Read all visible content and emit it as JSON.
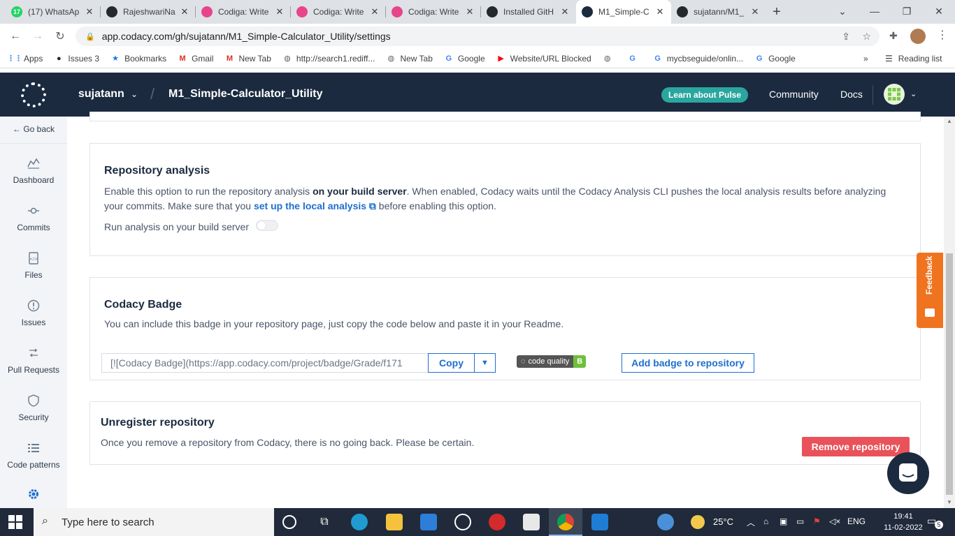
{
  "browser": {
    "tabs": [
      {
        "title": "(17) WhatsAp",
        "badge": "17",
        "color": "#25d366"
      },
      {
        "title": "RajeshwariNa",
        "color": "#24292e"
      },
      {
        "title": "Codiga: Write",
        "color": "#e8448b"
      },
      {
        "title": "Codiga: Write",
        "color": "#e8448b"
      },
      {
        "title": "Codiga: Write",
        "color": "#e8448b"
      },
      {
        "title": "Installed GitH",
        "color": "#24292e"
      },
      {
        "title": "M1_Simple-C",
        "color": "#1b2a3f",
        "active": true
      },
      {
        "title": "sujatann/M1_",
        "color": "#24292e"
      }
    ],
    "url": "app.codacy.com/gh/sujatann/M1_Simple-Calculator_Utility/settings",
    "bookmarks": [
      {
        "label": "Apps",
        "icon": "apps-grid-icon"
      },
      {
        "label": "Issues 3",
        "icon": "github-icon"
      },
      {
        "label": "Bookmarks",
        "icon": "star-icon"
      },
      {
        "label": "Gmail",
        "icon": "gmail-icon"
      },
      {
        "label": "New Tab",
        "icon": "gmail-icon"
      },
      {
        "label": "http://search1.rediff...",
        "icon": "globe-icon"
      },
      {
        "label": "New Tab",
        "icon": "globe-icon"
      },
      {
        "label": "Google",
        "icon": "google-icon"
      },
      {
        "label": "Website/URL Blocked",
        "icon": "youtube-icon"
      },
      {
        "label": "",
        "icon": "globe-icon"
      },
      {
        "label": "",
        "icon": "google-icon"
      },
      {
        "label": "mycbseguide/onlin...",
        "icon": "google-icon"
      },
      {
        "label": "Google",
        "icon": "google-icon"
      }
    ],
    "more": "»",
    "reading_list": "Reading list"
  },
  "header": {
    "org": "sujatann",
    "separator": "/",
    "repo": "M1_Simple-Calculator_Utility",
    "pulse": "Learn about Pulse",
    "community": "Community",
    "docs": "Docs"
  },
  "sidebar": {
    "go_back": "← Go back",
    "items": [
      {
        "label": "Dashboard"
      },
      {
        "label": "Commits"
      },
      {
        "label": "Files"
      },
      {
        "label": "Issues"
      },
      {
        "label": "Pull Requests"
      },
      {
        "label": "Security"
      },
      {
        "label": "Code patterns"
      }
    ]
  },
  "repo_analysis": {
    "title": "Repository analysis",
    "desc_1a": "Enable this option to run the repository analysis ",
    "desc_1b": "on your build server",
    "desc_1c": ". When enabled, Codacy waits until the Codacy Analysis CLI pushes the local analysis results before analyzing",
    "desc_2a": "your commits. Make sure that you ",
    "desc_2b": "set up the local analysis",
    "desc_2c": " before enabling this option.",
    "toggle_label": "Run analysis on your build server",
    "toggle_on": false
  },
  "badge": {
    "title": "Codacy Badge",
    "desc": "You can include this badge in your repository page, just copy the code below and paste it in your Readme.",
    "code": "[![Codacy Badge](https://app.codacy.com/project/badge/Grade/f171",
    "copy": "Copy",
    "badge_label": "code quality",
    "badge_grade": "B",
    "add": "Add badge to repository"
  },
  "unregister": {
    "title": "Unregister repository",
    "desc": "Once you remove a repository from Codacy, there is no going back. Please be certain.",
    "remove": "Remove repository"
  },
  "feedback": "Feedback",
  "taskbar": {
    "search": "Type here to search",
    "weather": "25°C",
    "lang": "ENG",
    "time": "19:41",
    "date": "11-02-2022",
    "notifications": "5"
  }
}
